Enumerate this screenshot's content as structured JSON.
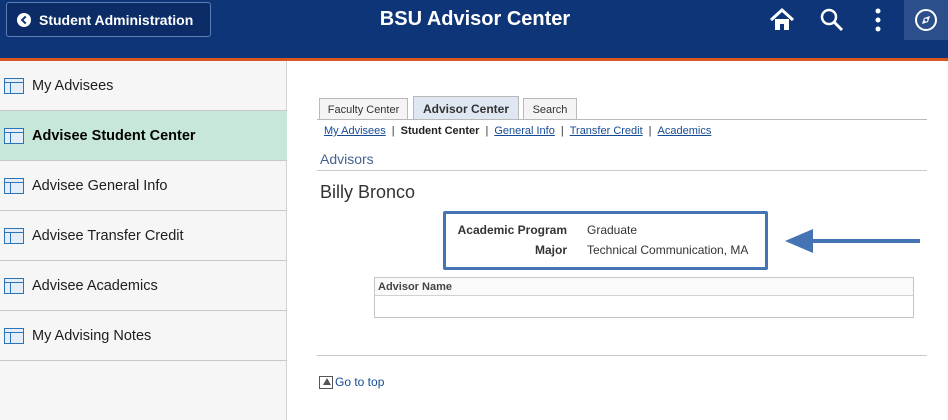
{
  "header": {
    "back_label": "Student Administration",
    "title": "BSU Advisor Center",
    "colors": {
      "bar": "#0d3577",
      "accent": "#d8571f"
    },
    "icons": [
      "home-icon",
      "search-icon",
      "more-options-icon",
      "navbar-compass-icon"
    ]
  },
  "sidebar": {
    "items": [
      {
        "label": "My Advisees"
      },
      {
        "label": "Advisee Student Center"
      },
      {
        "label": "Advisee General Info"
      },
      {
        "label": "Advisee Transfer Credit"
      },
      {
        "label": "Advisee Academics"
      },
      {
        "label": "My Advising Notes"
      }
    ],
    "active_index": 1,
    "active_color": "#c7e8d8"
  },
  "tabs": [
    {
      "label": "Faculty Center"
    },
    {
      "label": "Advisor Center"
    },
    {
      "label": "Search"
    }
  ],
  "sublinks": {
    "advisees": "My Advisees",
    "current": "Student Center",
    "general": "General Info",
    "transfer": "Transfer Credit",
    "academics": "Academics",
    "separator": "|"
  },
  "section_title": "Advisors",
  "student_name": "Billy Bronco",
  "program": {
    "program_label": "Academic Program",
    "program_value": "Graduate",
    "major_label": "Major",
    "major_value": "Technical Communication, MA"
  },
  "advisor_grid": {
    "column_header": "Advisor Name"
  },
  "goto_top": "Go to top",
  "annotation_color": "#4474b4"
}
